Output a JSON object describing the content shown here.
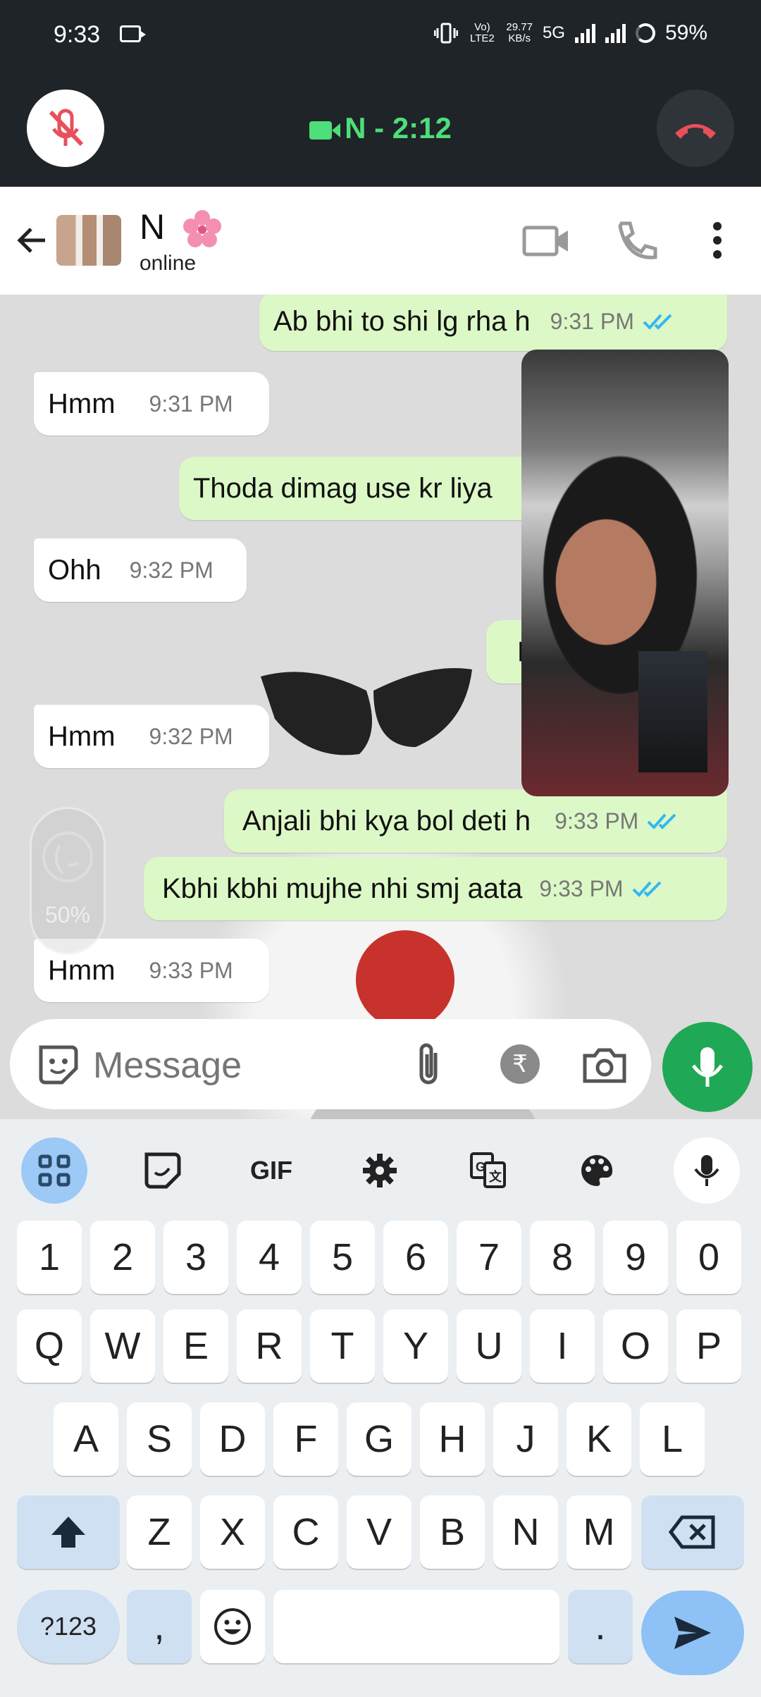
{
  "status_bar": {
    "time": "9:33",
    "net_line1": "Vo) LTE2",
    "net_speed": "29.77",
    "net_unit": "KB/s",
    "network": "5G",
    "battery": "59%"
  },
  "call": {
    "title": "N - 2:12"
  },
  "header": {
    "name": "N",
    "status": "online"
  },
  "messages": [
    {
      "direction": "out",
      "text": "Ab bhi to shi lg rha h",
      "time": "9:31 PM",
      "read": true
    },
    {
      "direction": "in",
      "text": "Hmm",
      "time": "9:31 PM"
    },
    {
      "direction": "out",
      "text": "Thoda dimag use kr liya",
      "time": ""
    },
    {
      "direction": "in",
      "text": "Ohh",
      "time": "9:32 PM"
    },
    {
      "direction": "out",
      "text": "H",
      "time": ""
    },
    {
      "direction": "in",
      "text": "Hmm",
      "time": "9:32 PM"
    },
    {
      "direction": "out",
      "text": "Anjali bhi kya bol deti h",
      "time": "9:33 PM",
      "read": true
    },
    {
      "direction": "out",
      "text": "Kbhi kbhi mujhe nhi smj aata",
      "time": "9:33 PM",
      "read": true
    },
    {
      "direction": "in",
      "text": "Hmm",
      "time": "9:33 PM"
    }
  ],
  "beauty_filter": {
    "level": "50%"
  },
  "compose": {
    "placeholder": "Message"
  },
  "keyboard": {
    "toolbar_gif": "GIF",
    "number_row": [
      "1",
      "2",
      "3",
      "4",
      "5",
      "6",
      "7",
      "8",
      "9",
      "0"
    ],
    "row1": [
      "Q",
      "W",
      "E",
      "R",
      "T",
      "Y",
      "U",
      "I",
      "O",
      "P"
    ],
    "row2": [
      "A",
      "S",
      "D",
      "F",
      "G",
      "H",
      "J",
      "K",
      "L"
    ],
    "row3": [
      "Z",
      "X",
      "C",
      "V",
      "B",
      "N",
      "M"
    ],
    "symbols_key": "?123",
    "comma_key": ",",
    "period_key": "."
  },
  "colors": {
    "call_green": "#4ede7a",
    "end_call_red": "#e8505b",
    "outgoing_bubble": "#dcf8c6",
    "read_ticks": "#34b7f1",
    "mic_button": "#1fa855",
    "keyboard_accent": "#9cc9f6"
  }
}
